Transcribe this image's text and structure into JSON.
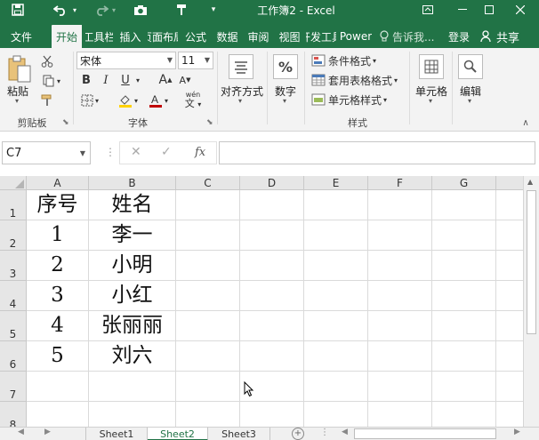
{
  "titlebar": {
    "title": "工作簿2 - Excel",
    "save_icon": "save-icon",
    "undo_icon": "undo-icon",
    "redo_icon": "redo-icon",
    "camera_icon": "camera-icon",
    "brush_icon": "format-painter-icon",
    "customize_icon": "chevron-down-icon"
  },
  "tabs": [
    {
      "label": "文件"
    },
    {
      "label": "开始"
    },
    {
      "label": "工具栏"
    },
    {
      "label": "插入"
    },
    {
      "label": "页面布局"
    },
    {
      "label": "公式"
    },
    {
      "label": "数据"
    },
    {
      "label": "审阅"
    },
    {
      "label": "视图"
    },
    {
      "label": "开发工具"
    },
    {
      "label": "Power"
    }
  ],
  "tellme": "告诉我...",
  "login": "登录",
  "share": "共享",
  "ribbon": {
    "clipboard": {
      "paste": "粘贴",
      "label": "剪贴板"
    },
    "font": {
      "name": "宋体",
      "size": "11",
      "bold": "B",
      "italic": "I",
      "underline": "U",
      "grow": "A",
      "shrink": "A",
      "wen": "wén",
      "label": "字体"
    },
    "align": {
      "label": "对齐方式"
    },
    "number": {
      "symbol": "%",
      "label": "数字"
    },
    "styles": {
      "cond": "条件格式",
      "table": "套用表格格式",
      "cell": "单元格样式",
      "label": "样式"
    },
    "cells": {
      "label": "单元格"
    },
    "edit": {
      "label": "编辑"
    }
  },
  "formula": {
    "cell_ref": "C7",
    "cancel": "✕",
    "enter": "✓",
    "fx": "fx",
    "value": ""
  },
  "columns": [
    "A",
    "B",
    "C",
    "D",
    "E",
    "F",
    "G"
  ],
  "rows": [
    {
      "n": "1",
      "a": "序号",
      "b": "姓名"
    },
    {
      "n": "2",
      "a": "1",
      "b": "李一"
    },
    {
      "n": "3",
      "a": "2",
      "b": "小明"
    },
    {
      "n": "4",
      "a": "3",
      "b": "小红"
    },
    {
      "n": "5",
      "a": "4",
      "b": "张丽丽"
    },
    {
      "n": "6",
      "a": "5",
      "b": "刘六"
    },
    {
      "n": "7",
      "a": "",
      "b": ""
    },
    {
      "n": "8",
      "a": "",
      "b": ""
    }
  ],
  "sheets": [
    {
      "label": "Sheet1"
    },
    {
      "label": "Sheet2"
    },
    {
      "label": "Sheet3"
    }
  ],
  "active_sheet": "Sheet2",
  "accent": "#217346"
}
